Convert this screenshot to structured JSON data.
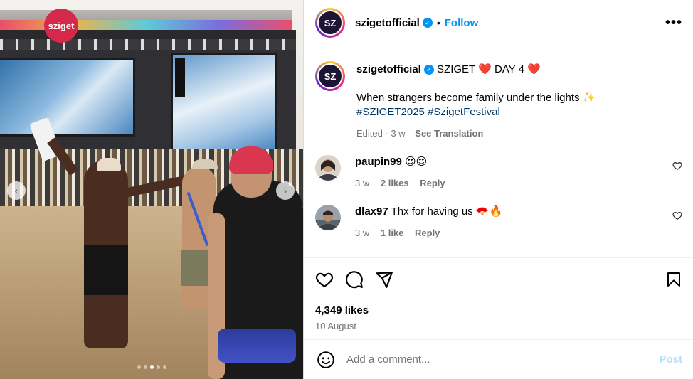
{
  "post": {
    "username": "szigetofficial",
    "avatar_text": "SZ",
    "follow_label": "Follow",
    "separator": "•",
    "more_label": "•••",
    "logo_text": "sziget"
  },
  "caption": {
    "username": "szigetofficial",
    "title": "SZIGET ❤️ DAY 4 ❤️",
    "body": "When strangers become family under the lights ✨",
    "hashtag1": "#SZIGET2025",
    "hashtag2": "#SzigetFestival",
    "edited": "Edited · 3 w",
    "translation": "See Translation"
  },
  "comments": [
    {
      "username": "paupin99",
      "text": "😍😍",
      "time": "3 w",
      "likes": "2 likes",
      "reply": "Reply"
    },
    {
      "username": "dlax97",
      "text": "Thx for having us 🪭🔥",
      "time": "3 w",
      "likes": "1 like",
      "reply": "Reply"
    }
  ],
  "stats": {
    "likes": "4,349 likes",
    "date": "10 August"
  },
  "comment_box": {
    "placeholder": "Add a comment...",
    "post_label": "Post"
  },
  "colors": {
    "accent": "#0095f6",
    "post_disabled": "#b2dffc",
    "secondary_text": "#737373"
  },
  "icons": [
    "verified-badge-icon",
    "more-options-icon",
    "heart-icon",
    "comment-icon",
    "share-icon",
    "bookmark-icon",
    "emoji-icon",
    "chevron-left-icon",
    "chevron-right-icon"
  ]
}
